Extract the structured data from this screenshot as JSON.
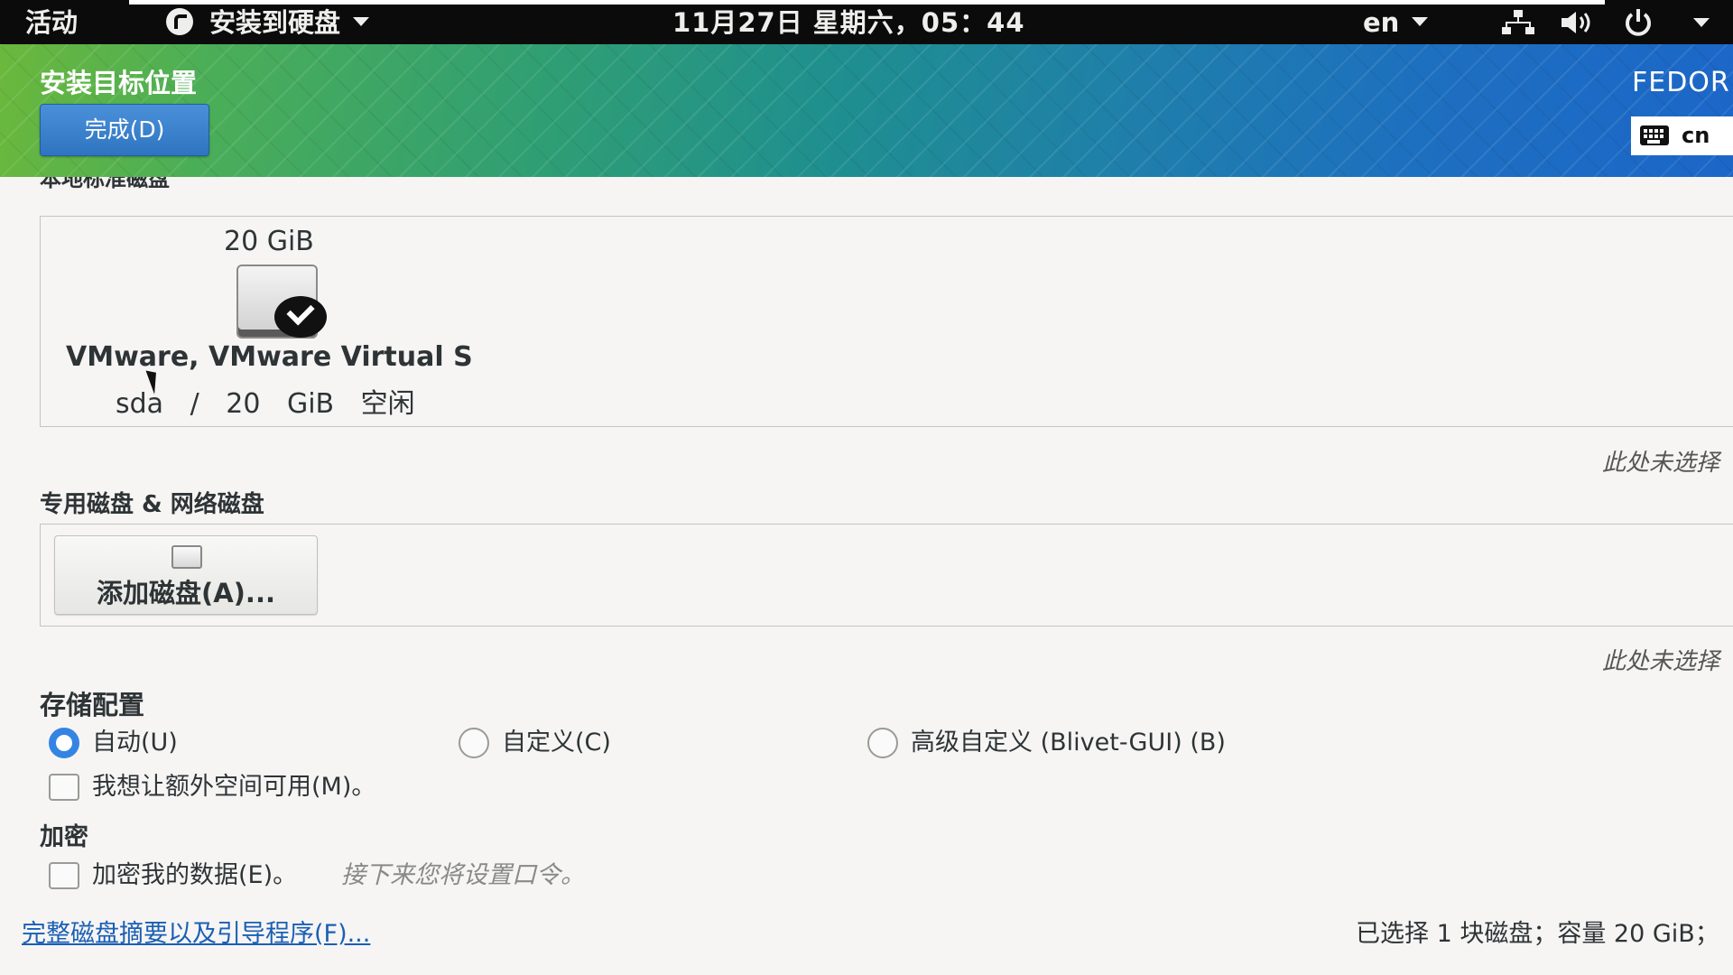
{
  "topbar": {
    "activities": "活动",
    "app_menu": "安装到硬盘",
    "clock": "11月27日 星期六，05：44",
    "language": "en"
  },
  "header": {
    "title": "安装目标位置",
    "done_button": "完成(D)",
    "distro": "FEDOR",
    "keyboard_layout": "cn"
  },
  "local_disks": {
    "section_title": "本地标准磁盘",
    "disk": {
      "size": "20 GiB",
      "name": "VMware, VMware Virtual S",
      "device": "sda",
      "separator": "/",
      "free": "20 GiB 空闲"
    },
    "note": "此处未选择"
  },
  "special_disks": {
    "section_title": "专用磁盘 & 网络磁盘",
    "add_button": "添加磁盘(A)...",
    "note": "此处未选择"
  },
  "storage_config": {
    "section_title": "存储配置",
    "options": [
      "自动(U)",
      "自定义(C)",
      "高级自定义 (Blivet-GUI) (B)"
    ],
    "selected": "自动(U)",
    "extra_space_label": "我想让额外空间可用(M)。"
  },
  "encryption": {
    "section_title": "加密",
    "encrypt_label": "加密我的数据(E)。",
    "hint": "接下来您将设置口令。"
  },
  "footer": {
    "summary_link": "完整磁盘摘要以及引导程序(F)...",
    "status": "已选择 1 块磁盘；容量 20 GiB；"
  },
  "colors": {
    "accent": "#3584e4",
    "link": "#1a5fb4",
    "topbar": "#0b0b0b"
  }
}
